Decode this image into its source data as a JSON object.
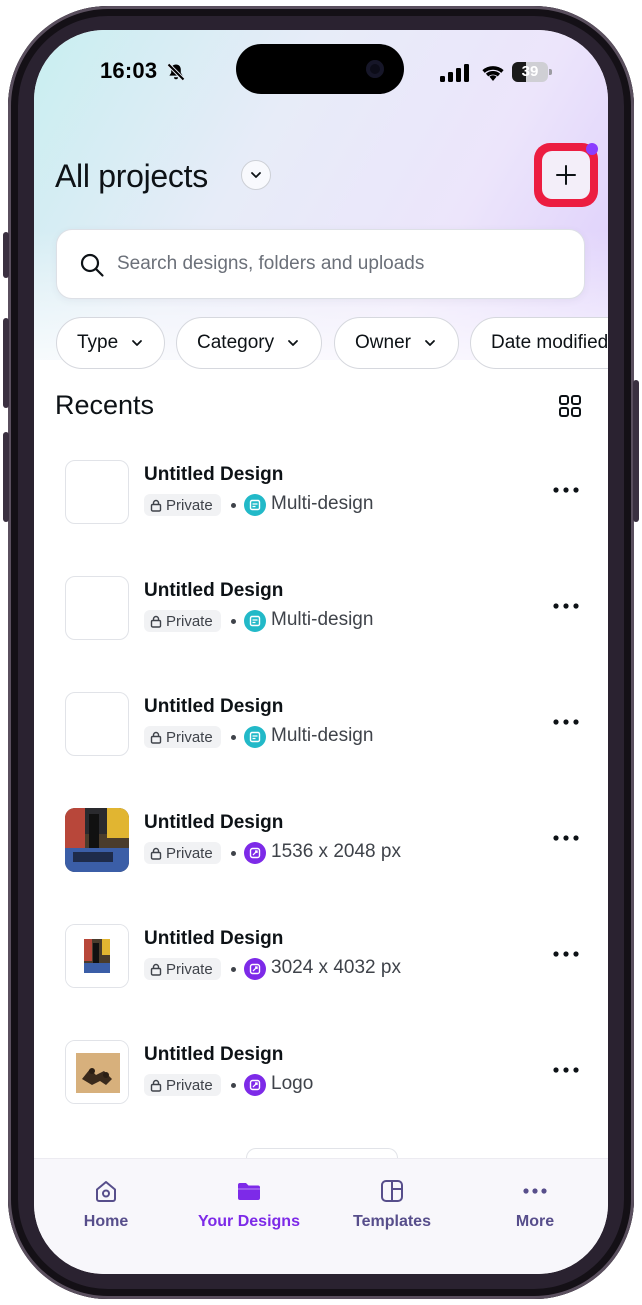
{
  "status_bar": {
    "time": "16:03",
    "battery": "39",
    "battery_level": 0.39
  },
  "header": {
    "title": "All projects",
    "create_label": "+"
  },
  "search": {
    "placeholder": "Search designs, folders and uploads"
  },
  "filters": [
    {
      "label": "Type"
    },
    {
      "label": "Category"
    },
    {
      "label": "Owner"
    },
    {
      "label": "Date modified"
    }
  ],
  "recents": {
    "title": "Recents",
    "items": [
      {
        "title": "Untitled Design",
        "privacy": "Private",
        "type": "Multi-design",
        "type_icon": "multi-design-icon"
      },
      {
        "title": "Untitled Design",
        "privacy": "Private",
        "type": "Multi-design",
        "type_icon": "multi-design-icon"
      },
      {
        "title": "Untitled Design",
        "privacy": "Private",
        "type": "Multi-design",
        "type_icon": "multi-design-icon"
      },
      {
        "title": "Untitled Design",
        "privacy": "Private",
        "type": "1536 x 2048 px",
        "type_icon": "custom-size-icon"
      },
      {
        "title": "Untitled Design",
        "privacy": "Private",
        "type": "3024 x 4032 px",
        "type_icon": "custom-size-icon"
      },
      {
        "title": "Untitled Design",
        "privacy": "Private",
        "type": "Logo",
        "type_icon": "custom-size-icon"
      }
    ]
  },
  "tabs": [
    {
      "label": "Home",
      "icon": "home-icon"
    },
    {
      "label": "Your Designs",
      "icon": "folder-icon",
      "active": true
    },
    {
      "label": "Templates",
      "icon": "templates-icon"
    },
    {
      "label": "More",
      "icon": "more-icon"
    }
  ],
  "colors": {
    "accent": "#7d2ae8",
    "highlight": "#ec1d41",
    "multi_design_icon": "#22b9c8",
    "custom_size_icon": "#7d2ae8",
    "nav_label": "#574e8b"
  }
}
